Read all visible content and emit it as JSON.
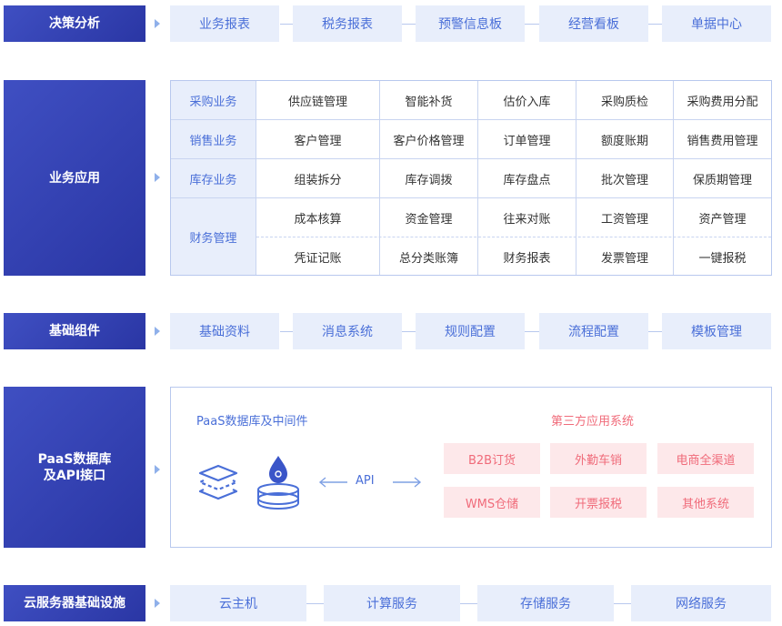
{
  "rows": {
    "decision": {
      "label": "决策分析",
      "items": [
        "业务报表",
        "税务报表",
        "预警信息板",
        "经营看板",
        "单据中心"
      ]
    },
    "business": {
      "label": "业务应用",
      "groups": [
        {
          "name": "采购业务",
          "items": [
            [
              "供应链管理",
              "智能补货",
              "估价入库",
              "采购质检",
              "采购费用分配"
            ]
          ]
        },
        {
          "name": "销售业务",
          "items": [
            [
              "客户管理",
              "客户价格管理",
              "订单管理",
              "额度账期",
              "销售费用管理"
            ]
          ]
        },
        {
          "name": "库存业务",
          "items": [
            [
              "组装拆分",
              "库存调拨",
              "库存盘点",
              "批次管理",
              "保质期管理"
            ]
          ]
        },
        {
          "name": "财务管理",
          "items": [
            [
              "成本核算",
              "资金管理",
              "往来对账",
              "工资管理",
              "资产管理"
            ],
            [
              "凭证记账",
              "总分类账簿",
              "财务报表",
              "发票管理",
              "一键报税"
            ]
          ]
        }
      ]
    },
    "base": {
      "label": "基础组件",
      "items": [
        "基础资料",
        "消息系统",
        "规则配置",
        "流程配置",
        "模板管理"
      ]
    },
    "paas": {
      "label_line1": "PaaS数据库",
      "label_line2": "及API接口",
      "db_title": "PaaS数据库及中间件",
      "api_label": "API",
      "third_title": "第三方应用系统",
      "third_items": [
        "B2B订货",
        "外勤车销",
        "电商全渠道",
        "WMS仓储",
        "开票报税",
        "其他系统"
      ]
    },
    "cloud": {
      "label": "云服务器基础设施",
      "items": [
        "云主机",
        "计算服务",
        "存储服务",
        "网络服务"
      ]
    }
  },
  "colors": {
    "side_bg": "#2f3cb0",
    "pill_bg": "#e8eefb",
    "pill_text": "#4a6fd8",
    "third_bg": "#fde8ea",
    "third_text": "#f06b7a"
  }
}
